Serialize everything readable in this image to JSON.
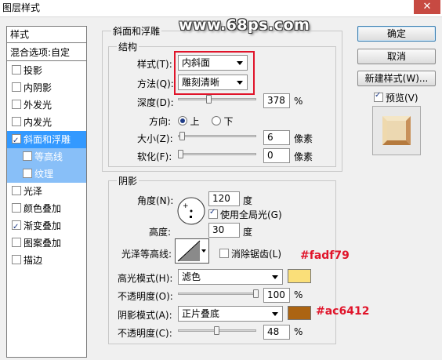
{
  "window": {
    "title": "图层样式",
    "close_glyph": "✕"
  },
  "watermark": "www.68ps.com",
  "left_panel": {
    "header": "样式",
    "blend_options": "混合选项:自定",
    "items": [
      {
        "label": "投影",
        "checked": false
      },
      {
        "label": "内阴影",
        "checked": false
      },
      {
        "label": "外发光",
        "checked": false
      },
      {
        "label": "内发光",
        "checked": false
      },
      {
        "label": "斜面和浮雕",
        "checked": true,
        "selected": true
      },
      {
        "label": "等高线",
        "checked": false,
        "sub": true
      },
      {
        "label": "纹理",
        "checked": false,
        "sub": true
      },
      {
        "label": "光泽",
        "checked": false
      },
      {
        "label": "颜色叠加",
        "checked": false
      },
      {
        "label": "渐变叠加",
        "checked": true
      },
      {
        "label": "图案叠加",
        "checked": false
      },
      {
        "label": "描边",
        "checked": false
      }
    ]
  },
  "bevel": {
    "group_title": "斜面和浮雕",
    "structure_title": "结构",
    "style_label": "样式(T):",
    "style_value": "内斜面",
    "technique_label": "方法(Q):",
    "technique_value": "雕刻清晰",
    "depth_label": "深度(D):",
    "depth_value": "378",
    "depth_unit": "%",
    "depth_level": 0.378,
    "direction_label": "方向:",
    "direction_up": "上",
    "direction_down": "下",
    "direction_selected": "上",
    "size_label": "大小(Z):",
    "size_value": "6",
    "size_unit": "像素",
    "size_level": 0.02,
    "soften_label": "软化(F):",
    "soften_value": "0",
    "soften_unit": "像素",
    "soften_level": 0.0
  },
  "shading": {
    "title": "阴影",
    "angle_label": "角度(N):",
    "angle_value": "120",
    "angle_unit": "度",
    "global_light_label": "使用全局光(G)",
    "global_light_checked": true,
    "altitude_label": "高度:",
    "altitude_value": "30",
    "altitude_unit": "度",
    "gloss_contour_label": "光泽等高线:",
    "anti_alias_label": "消除锯齿(L)",
    "anti_alias_checked": false,
    "highlight_mode_label": "高光模式(H):",
    "highlight_mode_value": "滤色",
    "highlight_color": "#fadf79",
    "highlight_opacity_label": "不透明度(O):",
    "highlight_opacity_value": "100",
    "highlight_opacity_unit": "%",
    "highlight_opacity_level": 1.0,
    "shadow_mode_label": "阴影模式(A):",
    "shadow_mode_value": "正片叠底",
    "shadow_color": "#ac6412",
    "shadow_opacity_label": "不透明度(C):",
    "shadow_opacity_value": "48",
    "shadow_opacity_unit": "%",
    "shadow_opacity_level": 0.48
  },
  "annotations": {
    "highlight_text": "#fadf79",
    "shadow_text": "#ac6412",
    "color": "#e0142a"
  },
  "buttons": {
    "ok": "确定",
    "cancel": "取消",
    "new_style": "新建样式(W)...",
    "preview_label": "预览(V)",
    "preview_checked": true
  }
}
